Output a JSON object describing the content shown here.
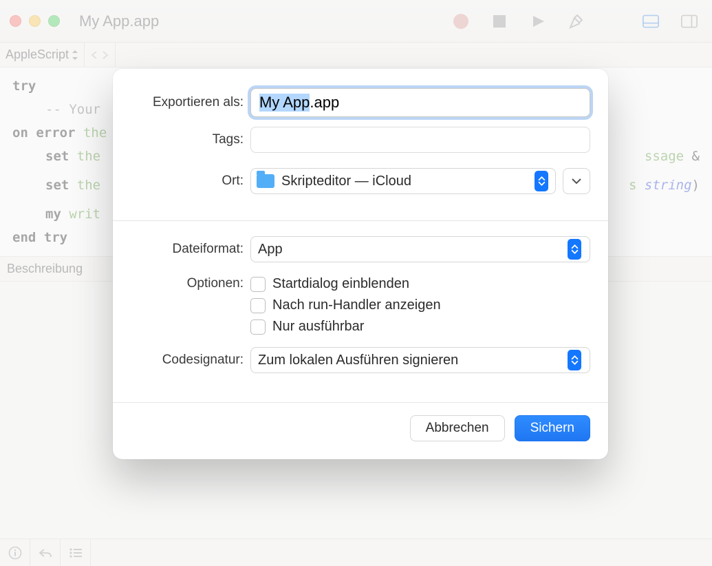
{
  "window": {
    "title": "My App.app"
  },
  "language_bar": {
    "language": "AppleScript"
  },
  "code": {
    "l1_kw": "try",
    "l2_cm": "-- Your",
    "l3_kw": "on error",
    "l3_gr": "the",
    "l4_kw": "set",
    "l4_gr": "the",
    "l4_tail_gr": "ssage",
    "l4_tail_amp": "&",
    "l5_kw": "set",
    "l5_gr": "the",
    "l5_tail_gr": "s",
    "l5_tail_it": "string",
    "l5_tail_paren": ")",
    "l6_kw": "my",
    "l6_gr": "writ",
    "l7_kw": "end try"
  },
  "description_label": "Beschreibung",
  "sheet": {
    "export_as_label": "Exportieren als:",
    "filename_selected": "My App",
    "filename_rest": ".app",
    "tags_label": "Tags:",
    "location_label": "Ort:",
    "location_value": "Skripteditor — iCloud",
    "format_label": "Dateiformat:",
    "format_value": "App",
    "options_label": "Optionen:",
    "options": [
      "Startdialog einblenden",
      "Nach run-Handler anzeigen",
      "Nur ausführbar"
    ],
    "codesign_label": "Codesignatur:",
    "codesign_value": "Zum lokalen Ausführen signieren",
    "cancel": "Abbrechen",
    "save": "Sichern"
  }
}
